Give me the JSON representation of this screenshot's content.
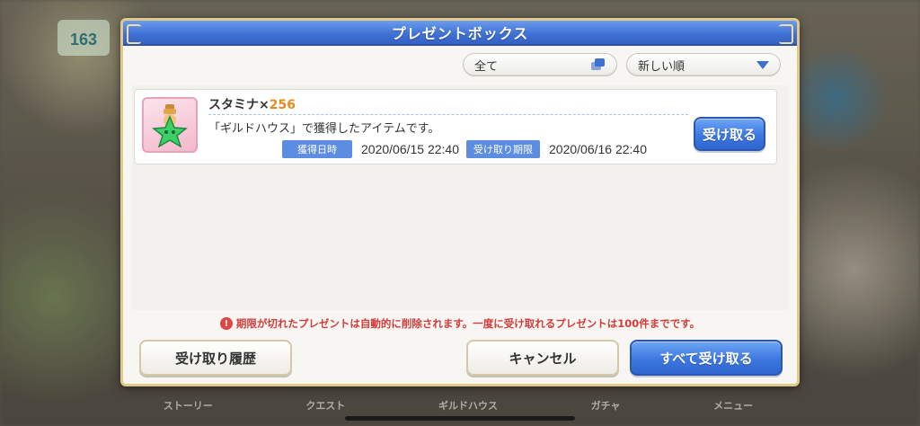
{
  "background": {
    "stamina_counter": "163",
    "tabs": [
      "ストーリー",
      "クエスト",
      "ギルドハウス",
      "ガチャ",
      "メニュー"
    ]
  },
  "dialog": {
    "title": "プレゼントボックス",
    "filter": {
      "selected": "全て",
      "icon": "copy-icon"
    },
    "sort": {
      "selected": "新しい順",
      "icon": "triangle-down-icon"
    },
    "items": [
      {
        "name": "スタミナ",
        "multiplier": "×",
        "quantity": "256",
        "description": "「ギルドハウス」で獲得したアイテムです。",
        "acquired_label": "獲得日時",
        "acquired_value": "2020/06/15 22:40",
        "expiry_label": "受け取り期限",
        "expiry_value": "2020/06/16 22:40",
        "receive_label": "受け取る",
        "icon": "stamina-potion-icon"
      }
    ],
    "notice": "期限が切れたプレゼントは自動的に削除されます。一度に受け取れるプレゼントは100件までです。",
    "buttons": {
      "history": "受け取り履歴",
      "cancel": "キャンセル",
      "receive_all": "すべて受け取る"
    }
  },
  "colors": {
    "title_bar": "#3e6fd2",
    "accent_blue": "#3d77e0",
    "notice_red": "#d43b3b",
    "quantity_orange": "#e98a1d",
    "frame_gold": "#e2c98a"
  }
}
